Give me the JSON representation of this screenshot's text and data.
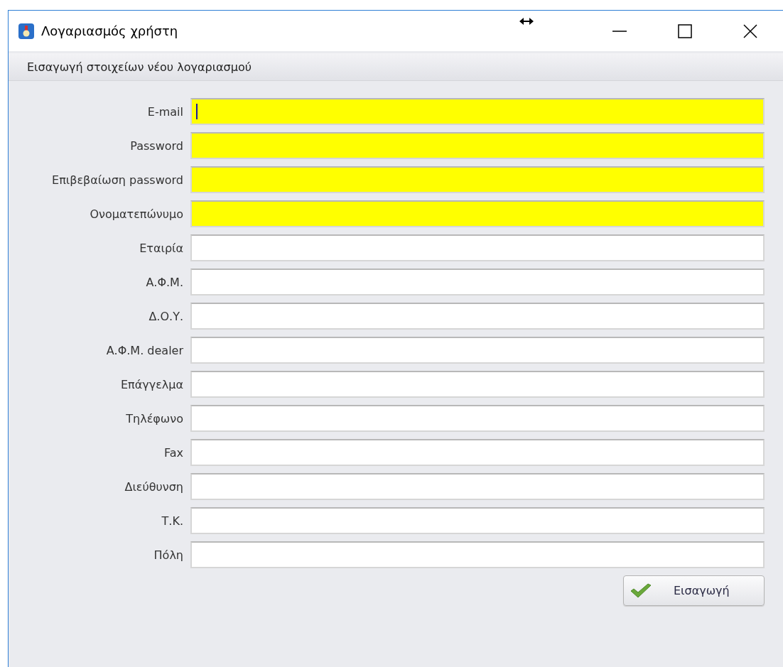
{
  "window": {
    "title": "Λογαριασμός χρήστη"
  },
  "group": {
    "title": "Εισαγωγή στοιχείων νέου λογαριασμού"
  },
  "fields": [
    {
      "label": "E-mail",
      "required": true,
      "focused": true
    },
    {
      "label": "Password",
      "required": true,
      "focused": false
    },
    {
      "label": "Επιβεβαίωση password",
      "required": true,
      "focused": false
    },
    {
      "label": "Ονοματεπώνυμο",
      "required": true,
      "focused": false
    },
    {
      "label": "Εταιρία",
      "required": false,
      "focused": false
    },
    {
      "label": "Α.Φ.Μ.",
      "required": false,
      "focused": false
    },
    {
      "label": "Δ.Ο.Υ.",
      "required": false,
      "focused": false
    },
    {
      "label": "Α.Φ.Μ. dealer",
      "required": false,
      "focused": false
    },
    {
      "label": "Επάγγελμα",
      "required": false,
      "focused": false
    },
    {
      "label": "Τηλέφωνο",
      "required": false,
      "focused": false
    },
    {
      "label": "Fax",
      "required": false,
      "focused": false
    },
    {
      "label": "Διεύθυνση",
      "required": false,
      "focused": false
    },
    {
      "label": "Τ.Κ.",
      "required": false,
      "focused": false
    },
    {
      "label": "Πόλη",
      "required": false,
      "focused": false
    }
  ],
  "submit_button": {
    "label": "Εισαγωγή"
  }
}
